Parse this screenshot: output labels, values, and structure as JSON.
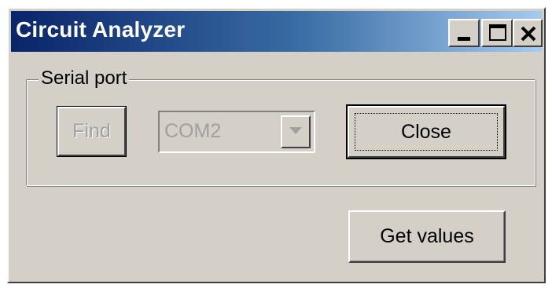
{
  "window": {
    "title": "Circuit Analyzer",
    "title_bar_colors": [
      "#0a246a",
      "#a6caf0"
    ],
    "controls": {
      "minimize_icon": "minimize-icon",
      "maximize_icon": "maximize-icon",
      "close_icon": "close-icon"
    }
  },
  "serial_port": {
    "group_label": "Serial port",
    "find_button": {
      "label": "Find",
      "enabled": false
    },
    "port_select": {
      "value": "COM2",
      "enabled": false,
      "dropdown_icon": "chevron-down-icon"
    },
    "close_button": {
      "label": "Close",
      "focused": true
    }
  },
  "actions": {
    "get_values_label": "Get values"
  }
}
